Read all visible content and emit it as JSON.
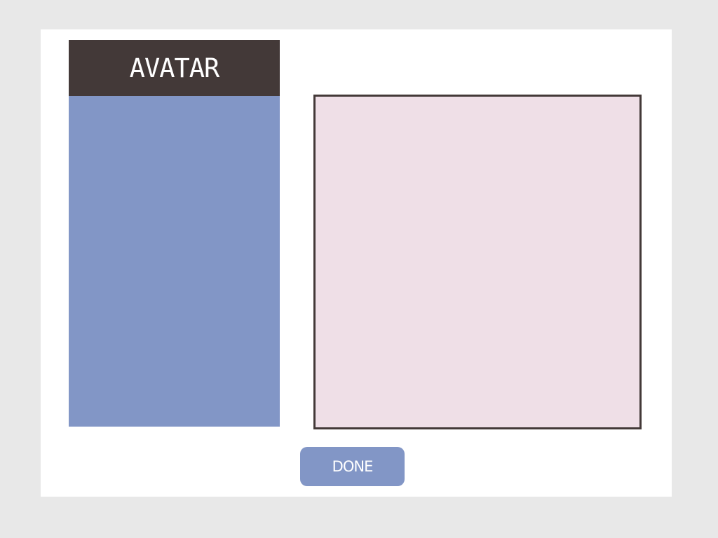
{
  "colors": {
    "page_background": "#e8e8e8",
    "card_background": "#ffffff",
    "header_background": "#433938",
    "avatar_list_background": "#8296c6",
    "preview_background": "#efdfe7",
    "preview_border": "#433938",
    "button_background": "#8296c6",
    "text_light": "#ffffff"
  },
  "avatar_panel": {
    "title": "AVATAR"
  },
  "actions": {
    "done_label": "DONE"
  }
}
